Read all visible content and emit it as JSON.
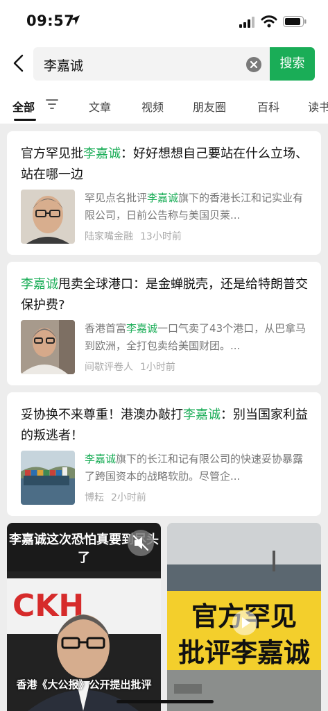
{
  "status": {
    "time": "09:57"
  },
  "search": {
    "query": "李嘉诚",
    "button": "搜索"
  },
  "tabs": [
    "全部",
    "文章",
    "视频",
    "朋友圈",
    "百科",
    "读书"
  ],
  "results": [
    {
      "title_pre": "官方罕见批",
      "title_hl": "李嘉诚",
      "title_post": "：好好想想自己要站在什么立场、站在哪一边",
      "snip_pre": "罕见点名批评",
      "snip_hl": "李嘉诚",
      "snip_post": "旗下的香港长江和记实业有限公司，日前公告称与美国贝莱...",
      "source": "陆家嘴金融",
      "time": "13小时前"
    },
    {
      "title_pre": "",
      "title_hl": "李嘉诚",
      "title_post": "甩卖全球港口：是金蝉脱壳，还是给特朗普交保护费?",
      "snip_pre": "香港首富",
      "snip_hl": "李嘉诚",
      "snip_post": "一口气卖了43个港口，从巴拿马到欧洲，全打包卖给美国财团。...",
      "source": "间歇评卷人",
      "time": "1小时前"
    },
    {
      "title_pre": "妥协换不来尊重！港澳办敲打",
      "title_hl": "李嘉诚",
      "title_post": "：别当国家利益的叛逃者！",
      "snip_pre": "",
      "snip_hl": "李嘉诚",
      "snip_post": "旗下的长江和记有限公司的快速妥协暴露了跨国资本的战略软肋。尽管企...",
      "source": "博耘",
      "time": "2小时前"
    }
  ],
  "videos": [
    {
      "caption_top": "李嘉诚这次恐怕真要到尽头了",
      "caption_bottom": "香港《大公报》公开提出批评",
      "logo": "CKH"
    },
    {
      "line1": "官方罕见",
      "line2": "批评李嘉诚"
    }
  ]
}
